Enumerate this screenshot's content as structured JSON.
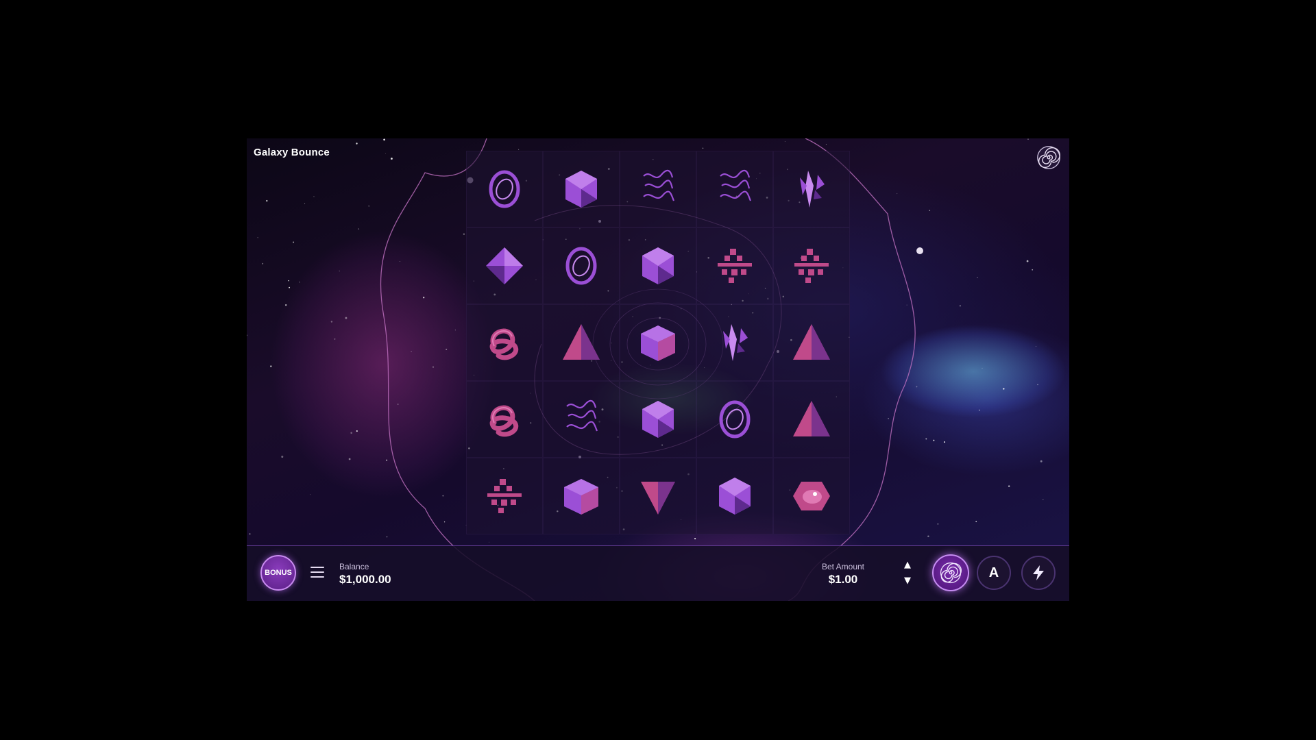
{
  "game": {
    "title": "Galaxy Bounce",
    "logo_icon": "spiral-icon"
  },
  "reels": [
    [
      "ring-icon",
      "hexagon-icon",
      "squiggle-icon",
      "squiggle-icon",
      "crystal-cluster-icon"
    ],
    [
      "diamond-icon",
      "ring-icon",
      "hexagon-icon",
      "block-cluster-icon",
      "block-cluster-icon"
    ],
    [
      "knot-icon",
      "pyramid-icon",
      "cube-icon",
      "crystal-cluster-icon",
      "pyramid-icon"
    ],
    [
      "knot-icon",
      "squiggle-icon",
      "hexagon-icon",
      "ring-icon",
      "pyramid-icon"
    ],
    [
      "block-cluster-icon",
      "cube-icon",
      "inverted-pyramid-icon",
      "hexagon-icon",
      "eye-gem-icon"
    ]
  ],
  "bottom_bar": {
    "bonus_label": "BONUS",
    "balance_label": "Balance",
    "balance_value": "$1,000.00",
    "bet_label": "Bet Amount",
    "bet_value": "$1.00",
    "bet_up_icon": "triangle-up-icon",
    "bet_down_icon": "triangle-down-icon",
    "spin_icon": "spiral-icon",
    "autoplay_label": "A",
    "turbo_icon": "lightning-icon"
  },
  "colors": {
    "accent": "#c98bf0",
    "symbol_purple": "#9b4fd6",
    "symbol_pink": "#c04a8a",
    "panel": "#160e28"
  }
}
